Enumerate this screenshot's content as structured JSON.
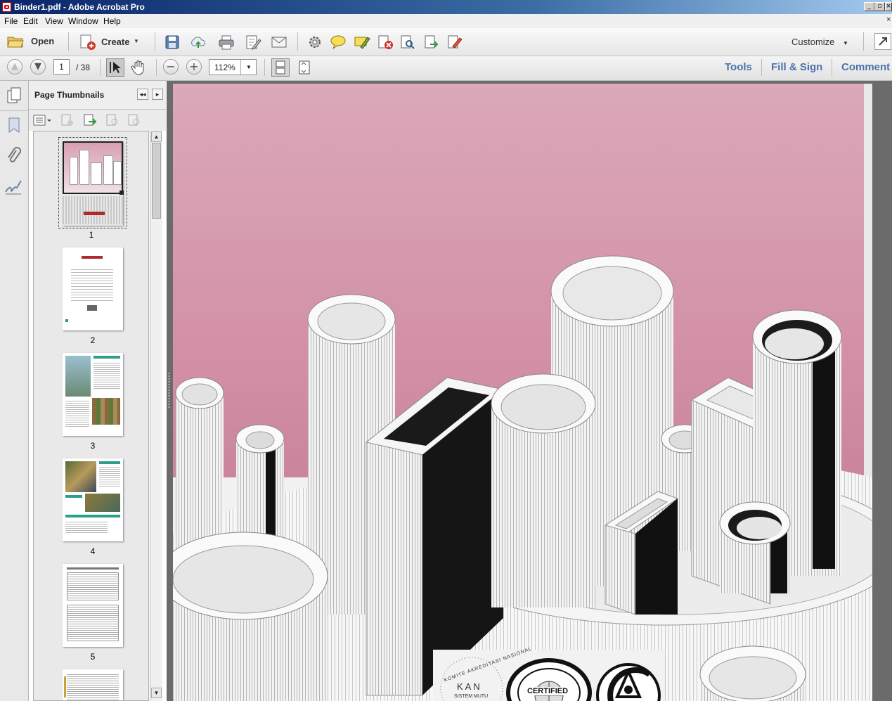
{
  "window": {
    "title": "Binder1.pdf - Adobe Acrobat Pro"
  },
  "menu": [
    "File",
    "Edit",
    "View",
    "Window",
    "Help"
  ],
  "toolbar": {
    "open_label": "Open",
    "create_label": "Create",
    "customize_label": "Customize"
  },
  "nav": {
    "current_page": "1",
    "page_total": "/ 38",
    "zoom": "112%"
  },
  "panes": {
    "tools": "Tools",
    "fill_sign": "Fill & Sign",
    "comment": "Comment"
  },
  "thumbnails": {
    "title": "Page Thumbnails",
    "pages": [
      "1",
      "2",
      "3",
      "4",
      "5"
    ]
  },
  "document": {
    "seal_kan_text": "KAN",
    "seal_kan_ring": "KOMITE AKREDITASI NASIONAL",
    "seal_kan_sub": "SISTEM MUTU",
    "seal_certified": "CERTIFIED"
  },
  "colors": {
    "page_bg_top": "#d9a8b7",
    "pane_link": "#4a73a8",
    "titlebar": "#0a246a"
  }
}
